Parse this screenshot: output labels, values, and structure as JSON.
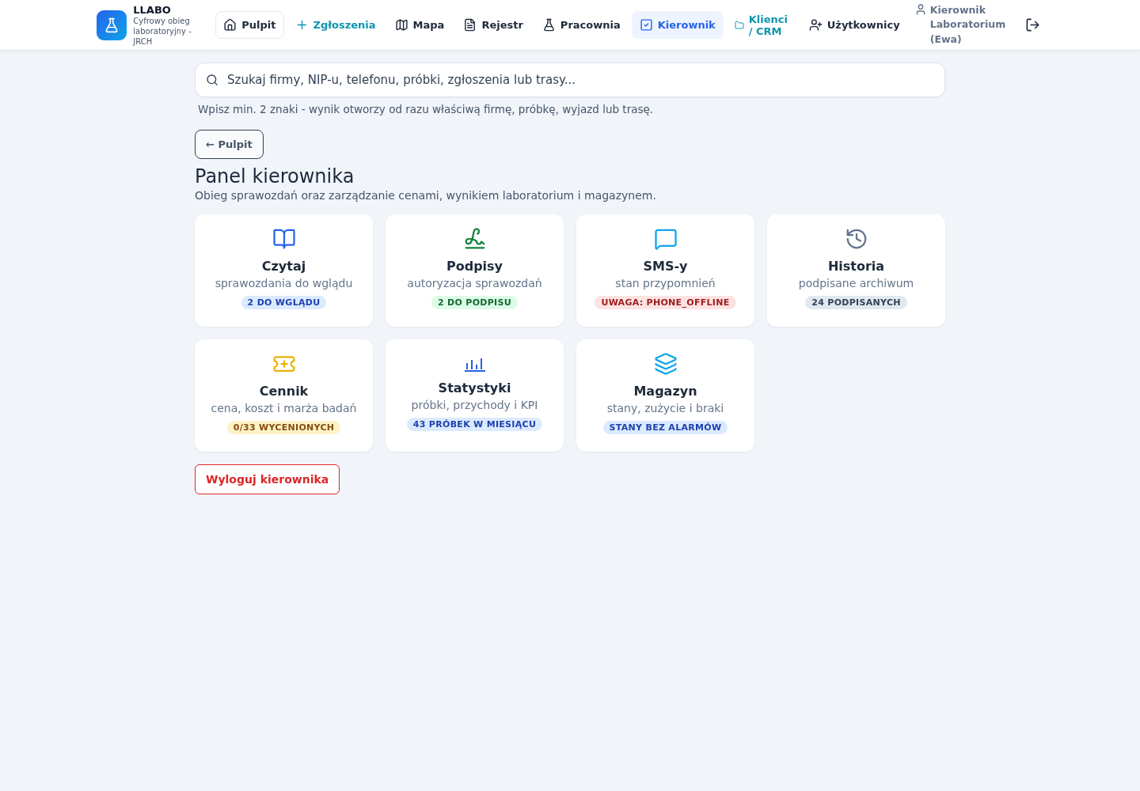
{
  "brand": {
    "title": "LLABO",
    "subtitle": "Cyfrowy obieg laboratoryjny - JRCH"
  },
  "nav": [
    {
      "label": "Pulpit",
      "kind": "boxed",
      "selected": false
    },
    {
      "label": "Zgłoszenia",
      "kind": "accent",
      "selected": false
    },
    {
      "label": "Mapa",
      "kind": "plain",
      "selected": false
    },
    {
      "label": "Rejestr",
      "kind": "plain",
      "selected": false
    },
    {
      "label": "Pracownia",
      "kind": "plain",
      "selected": false
    },
    {
      "label": "Kierownik",
      "kind": "plain",
      "selected": true
    },
    {
      "label": "Klienci / CRM",
      "kind": "accent",
      "selected": false
    },
    {
      "label": "Użytkownicy",
      "kind": "plain",
      "selected": false
    }
  ],
  "user": "Kierownik Laboratorium (Ewa)",
  "search": {
    "placeholder": "Szukaj firmy, NIP-u, telefonu, próbki, zgłoszenia lub trasy...",
    "hint": "Wpisz min. 2 znaki - wynik otworzy od razu właściwą firmę, próbkę, wyjazd lub trasę."
  },
  "back_button": "← Pulpit",
  "title": "Panel kierownika",
  "subtitle": "Obieg sprawozdań oraz zarządzanie cenami, wynikiem laboratorium i magazynem.",
  "cards": [
    {
      "title": "Czytaj",
      "description": "sprawozdania do wglądu",
      "badge": "2 DO WGLĄDU",
      "color": "#dbeafe"
    },
    {
      "title": "Podpisy",
      "description": "autoryzacja sprawozdań",
      "badge": "2 DO PODPISU",
      "color": "#dcfce7"
    },
    {
      "title": "SMS-y",
      "description": "stan przypomnień",
      "badge": "UWAGA: PHONE_OFFLINE",
      "color": "#fee2e2"
    },
    {
      "title": "Historia",
      "description": "podpisane archiwum",
      "badge": "24 PODPISANYCH",
      "color": "#e2e8f0"
    },
    {
      "title": "Cennik",
      "description": "cena, koszt i marża badań",
      "badge": "0/33 WYCENIONYCH",
      "color": "#fef3c7"
    },
    {
      "title": "Statystyki",
      "description": "próbki, przychody i KPI",
      "badge": "43 PRÓBEK W MIESIĄCU",
      "color": "#dbeafe"
    },
    {
      "title": "Magazyn",
      "description": "stany, zużycie i braki",
      "badge": "STANY BEZ ALARMÓW",
      "color": "#dbeafe"
    }
  ],
  "logout_button": "Wyloguj kierownika"
}
